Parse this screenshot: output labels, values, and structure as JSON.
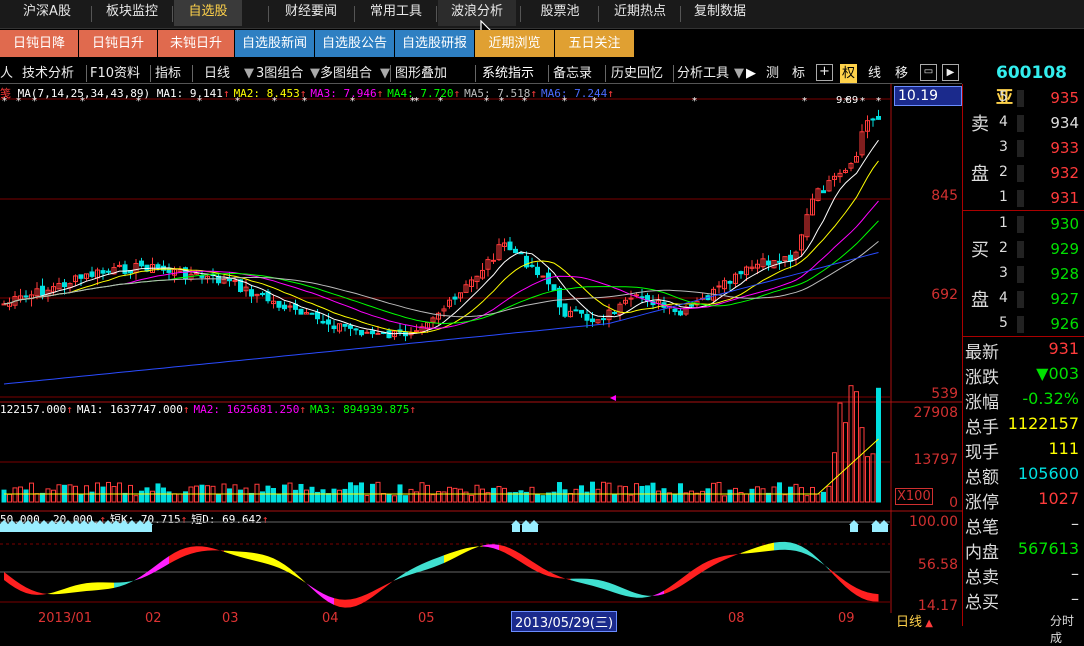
{
  "topnav": {
    "items": [
      {
        "label": "沪深A股",
        "active": false
      },
      {
        "label": "板块监控",
        "active": false
      },
      {
        "label": "自选股",
        "active": true
      },
      {
        "label": "财经要闻",
        "active": false
      },
      {
        "label": "常用工具",
        "active": false
      },
      {
        "label": "波浪分析",
        "active": false,
        "hover": true
      },
      {
        "label": "股票池",
        "active": false
      },
      {
        "label": "近期热点",
        "active": false
      },
      {
        "label": "复制数据",
        "active": false
      }
    ]
  },
  "subnav": {
    "items": [
      {
        "label": "日钝日降",
        "color": "#e06a4e"
      },
      {
        "label": "日钝日升",
        "color": "#e06a4e"
      },
      {
        "label": "未钝日升",
        "color": "#e06a4e"
      },
      {
        "label": "自选股新闻",
        "color": "#2e7fc2"
      },
      {
        "label": "自选股公告",
        "color": "#2e7fc2"
      },
      {
        "label": "自选股研报",
        "color": "#2e7fc2"
      },
      {
        "label": "近期浏览",
        "color": "#e0a032"
      },
      {
        "label": "五日关注",
        "color": "#e0a032"
      }
    ]
  },
  "toolbar": {
    "items": [
      "人",
      "技术分析",
      "F10资料",
      "指标",
      "日线",
      "3图组合",
      "多图组合",
      "图形叠加",
      "系统指示",
      "备忘录",
      "历史回忆",
      "分析工具",
      "测",
      "标",
      "权",
      "线",
      "移"
    ],
    "active": "权"
  },
  "stock": {
    "code": "600108",
    "name_fragment": "亚"
  },
  "ma_legend": {
    "label": "MA(7,14,25,34,43,89)",
    "items": [
      {
        "text": "MA1: 9.141",
        "color": "#ffffff"
      },
      {
        "text": "MA2: 8.453",
        "color": "#ffff00"
      },
      {
        "text": "MA3: 7.946",
        "color": "#ff00ff"
      },
      {
        "text": "MA4: 7.720",
        "color": "#00ff00"
      },
      {
        "text": "MA5: 7.518",
        "color": "#bbbbbb"
      },
      {
        "text": "MA6: 7.244",
        "color": "#4a6bff"
      }
    ]
  },
  "vol_legend": {
    "items": [
      {
        "text": "122157.000",
        "color": "#ffffff"
      },
      {
        "text": "MA1: 1637747.000",
        "color": "#ffffff"
      },
      {
        "text": "MA2: 1625681.250",
        "color": "#ff00ff"
      },
      {
        "text": "MA3: 894939.875",
        "color": "#00ff00"
      }
    ]
  },
  "kd_legend": {
    "items": [
      {
        "text": "50.000, 20.000,",
        "color": "#ffffff"
      },
      {
        "text": "短K: 70.715",
        "color": "#ffffff"
      },
      {
        "text": "短D: 69.642",
        "color": "#ffffff"
      }
    ]
  },
  "price_axis": {
    "top": "10.19",
    "l1": "845",
    "l2": "692",
    "l3": "539"
  },
  "vol_axis": {
    "top": "27908",
    "mid": "13797",
    "bottom": "0",
    "mult": "X100"
  },
  "kd_axis": {
    "top": "100.00",
    "mid": "56.58",
    "bottom": "14.17"
  },
  "peak_label": "9.89",
  "dates": [
    "2013/01",
    "02",
    "03",
    "04",
    "05",
    "2013/05/29(三)",
    "08",
    "09"
  ],
  "bottom_right": "日线",
  "bottom_far": "分时成",
  "orderbook": {
    "sell_label": [
      "卖",
      "盘"
    ],
    "buy_label": [
      "买",
      "盘"
    ],
    "sell": [
      {
        "n": "5",
        "p": "935"
      },
      {
        "n": "4",
        "p": "934"
      },
      {
        "n": "3",
        "p": "933"
      },
      {
        "n": "2",
        "p": "932"
      },
      {
        "n": "1",
        "p": "931"
      }
    ],
    "buy": [
      {
        "n": "1",
        "p": "930"
      },
      {
        "n": "2",
        "p": "929"
      },
      {
        "n": "3",
        "p": "928"
      },
      {
        "n": "4",
        "p": "927"
      },
      {
        "n": "5",
        "p": "926"
      }
    ]
  },
  "stats": [
    {
      "label": "最新",
      "value": "931",
      "color": "#ff3b3b"
    },
    {
      "label": "涨跌",
      "value": "▼003",
      "color": "#00e000"
    },
    {
      "label": "涨幅",
      "value": "-0.32%",
      "color": "#00e000"
    },
    {
      "label": "总手",
      "value": "1122157",
      "color": "#ffff00"
    },
    {
      "label": "现手",
      "value": "111",
      "color": "#ffff00"
    },
    {
      "label": "总额",
      "value": "105600",
      "color": "#00e0e0"
    },
    {
      "label": "涨停",
      "value": "1027",
      "color": "#ff3b3b"
    },
    {
      "label": "总笔",
      "value": "–",
      "color": "#dddddd"
    },
    {
      "label": "内盘",
      "value": "567613",
      "color": "#00e000"
    },
    {
      "label": "总卖",
      "value": "–",
      "color": "#dddddd"
    },
    {
      "label": "总买",
      "value": "–",
      "color": "#dddddd"
    }
  ],
  "colors": {
    "up": "#ff3b3b",
    "down": "#00e0e0",
    "grid": "#8a0000",
    "axis": "#d03030"
  }
}
